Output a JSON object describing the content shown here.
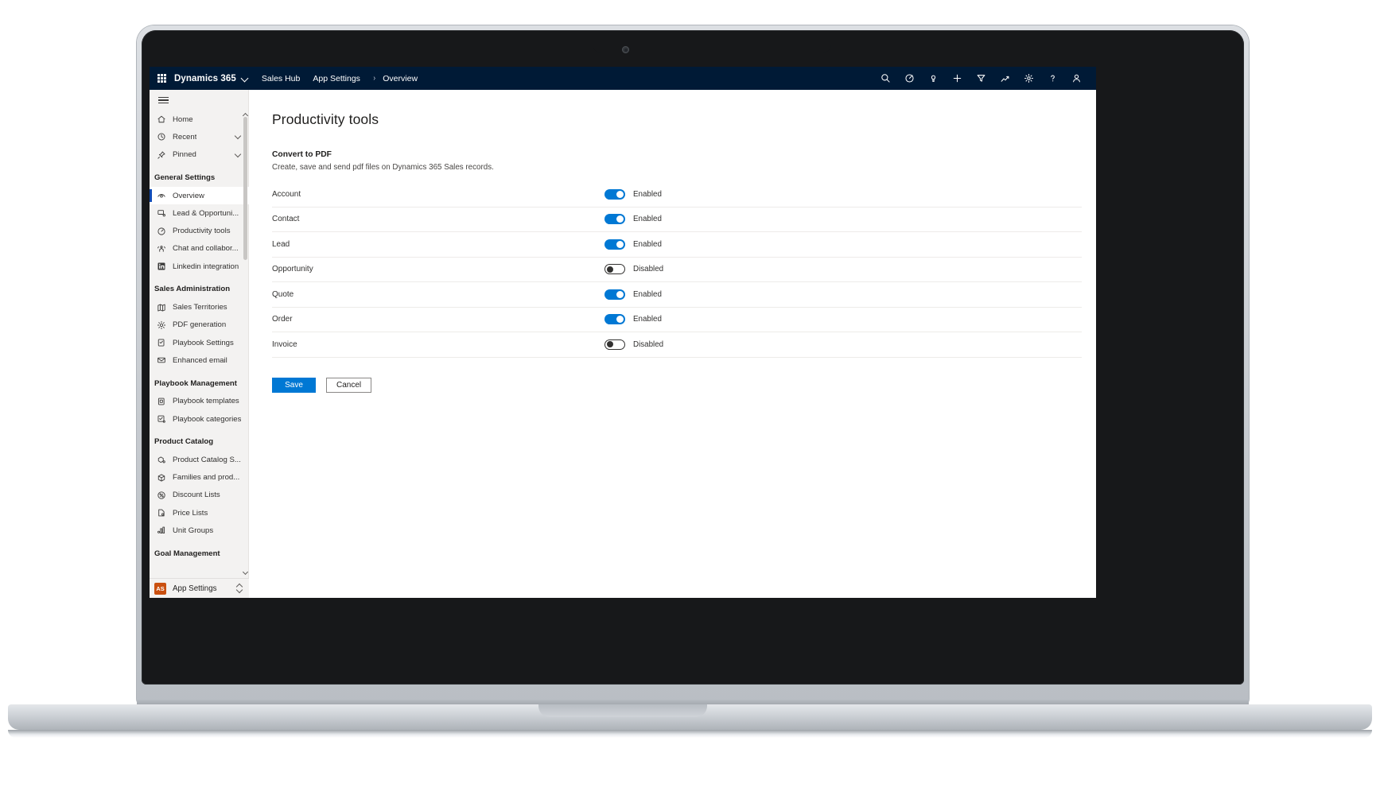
{
  "topbar": {
    "waffle_label": "app-launcher",
    "brand": "Dynamics 365",
    "app_name": "Sales Hub",
    "breadcrumb": [
      {
        "label": "App Settings"
      },
      {
        "label": "Overview"
      }
    ],
    "crumb_separator": "›",
    "icons": [
      {
        "name": "search-icon",
        "title": "Search"
      },
      {
        "name": "diagnostics-icon",
        "title": "Diagnostics"
      },
      {
        "name": "lightbulb-icon",
        "title": "Ideas"
      },
      {
        "name": "plus-icon",
        "title": "New"
      },
      {
        "name": "filter-icon",
        "title": "Filter"
      },
      {
        "name": "relationship-assistant-icon",
        "title": "Assistant"
      },
      {
        "name": "settings-gear-icon",
        "title": "Settings"
      },
      {
        "name": "help-question-icon",
        "title": "Help"
      },
      {
        "name": "user-account-icon",
        "title": "Account manager"
      }
    ]
  },
  "sidebar": {
    "hamburger_label": "Show/Hide navigation",
    "quick": [
      {
        "label": "Home",
        "icon": "home-icon",
        "chevron": false
      },
      {
        "label": "Recent",
        "icon": "clock-icon",
        "chevron": true
      },
      {
        "label": "Pinned",
        "icon": "pin-icon",
        "chevron": true
      }
    ],
    "groups": [
      {
        "title": "General Settings",
        "items": [
          {
            "label": "Overview",
            "icon": "overview-icon",
            "selected": true
          },
          {
            "label": "Lead & Opportuni...",
            "icon": "lead-opportunity-icon",
            "selected": false
          },
          {
            "label": "Productivity tools",
            "icon": "productivity-icon",
            "selected": false
          },
          {
            "label": "Chat and collabor...",
            "icon": "chat-collaboration-icon",
            "selected": false
          },
          {
            "label": "Linkedin integration",
            "icon": "linkedin-icon",
            "selected": false
          }
        ]
      },
      {
        "title": "Sales Administration",
        "items": [
          {
            "label": "Sales Territories",
            "icon": "map-icon",
            "selected": false
          },
          {
            "label": "PDF generation",
            "icon": "gear-icon",
            "selected": false
          },
          {
            "label": "Playbook Settings",
            "icon": "playbook-settings-icon",
            "selected": false
          },
          {
            "label": "Enhanced email",
            "icon": "mail-icon",
            "selected": false
          }
        ]
      },
      {
        "title": "Playbook Management",
        "items": [
          {
            "label": "Playbook templates",
            "icon": "playbook-template-icon",
            "selected": false
          },
          {
            "label": "Playbook categories",
            "icon": "playbook-category-icon",
            "selected": false
          }
        ]
      },
      {
        "title": "Product Catalog",
        "items": [
          {
            "label": "Product Catalog S...",
            "icon": "product-catalog-icon",
            "selected": false
          },
          {
            "label": "Families and prod...",
            "icon": "box-icon",
            "selected": false
          },
          {
            "label": "Discount Lists",
            "icon": "percent-icon",
            "selected": false
          },
          {
            "label": "Price Lists",
            "icon": "price-list-icon",
            "selected": false
          },
          {
            "label": "Unit Groups",
            "icon": "unit-groups-icon",
            "selected": false
          }
        ]
      },
      {
        "title": "Goal Management",
        "items": []
      }
    ],
    "app_switcher": {
      "badge": "AS",
      "label": "App Settings"
    }
  },
  "main": {
    "title": "Productivity tools",
    "section": {
      "heading": "Convert to PDF",
      "description": "Create, save and send pdf files on Dynamics 365 Sales records."
    },
    "rows": [
      {
        "label": "Account",
        "enabled": true,
        "state": "Enabled"
      },
      {
        "label": "Contact",
        "enabled": true,
        "state": "Enabled"
      },
      {
        "label": "Lead",
        "enabled": true,
        "state": "Enabled"
      },
      {
        "label": "Opportunity",
        "enabled": false,
        "state": "Disabled"
      },
      {
        "label": "Quote",
        "enabled": true,
        "state": "Enabled"
      },
      {
        "label": "Order",
        "enabled": true,
        "state": "Enabled"
      },
      {
        "label": "Invoice",
        "enabled": false,
        "state": "Disabled"
      }
    ],
    "buttons": {
      "save": "Save",
      "cancel": "Cancel"
    }
  },
  "colors": {
    "topbar_bg": "#001a36",
    "accent": "#0078d4",
    "sidebar_bg": "#f3f2f1",
    "selected_bar": "#0f4bb7",
    "app_badge": "#ca5010"
  }
}
